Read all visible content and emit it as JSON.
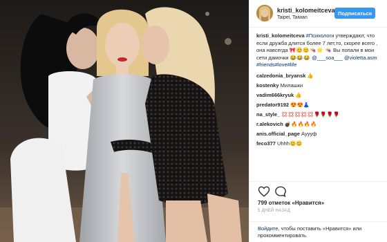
{
  "post": {
    "username": "kristi_kolomeitceva",
    "location": "Taipei, Taiwan",
    "follow_label": "Подписаться",
    "caption": {
      "user": "kristi_kolomeitceva",
      "hashtag_first": "#Психологи",
      "text_1": " утверждают, что если дружба длится более 7 лет,то, скорее всего , она навсегда ",
      "emoji_1": "🎀😊😊👒🌟",
      "emoji_2": "👒",
      "text_2": " Вы попали в мои сети дамочки ",
      "emoji_3": "😂😂😂",
      "mention_1": "@___soa___",
      "mention_2": "@violetta.asm",
      "hashtags": "#friends#love#life"
    },
    "comments": [
      {
        "user": "calzedonia_bryansk",
        "text": "👍"
      },
      {
        "user": "kostenky",
        "text": "Милашки"
      },
      {
        "user": "vadim666kryuk",
        "text": "👍"
      },
      {
        "user": "predator9192",
        "text": "😍😍👗"
      },
      {
        "user": "na_style_",
        "text": "💢💢💢💢💢🌹🌹🌹🌹"
      },
      {
        "user": "r.alekovich",
        "text": "💣🔥🔥🔥🔥"
      },
      {
        "user": "anis.official_page",
        "text": "Ауууф"
      },
      {
        "user": "feco377",
        "text": "Uhhh😊😊"
      }
    ],
    "likes_text": "799 отметок «Нравится»",
    "time_text": "5 ДНЕЙ НАЗАД",
    "login_link": "Войдите",
    "login_text": ", чтобы поставить «Нравится» или прокомментировать."
  }
}
